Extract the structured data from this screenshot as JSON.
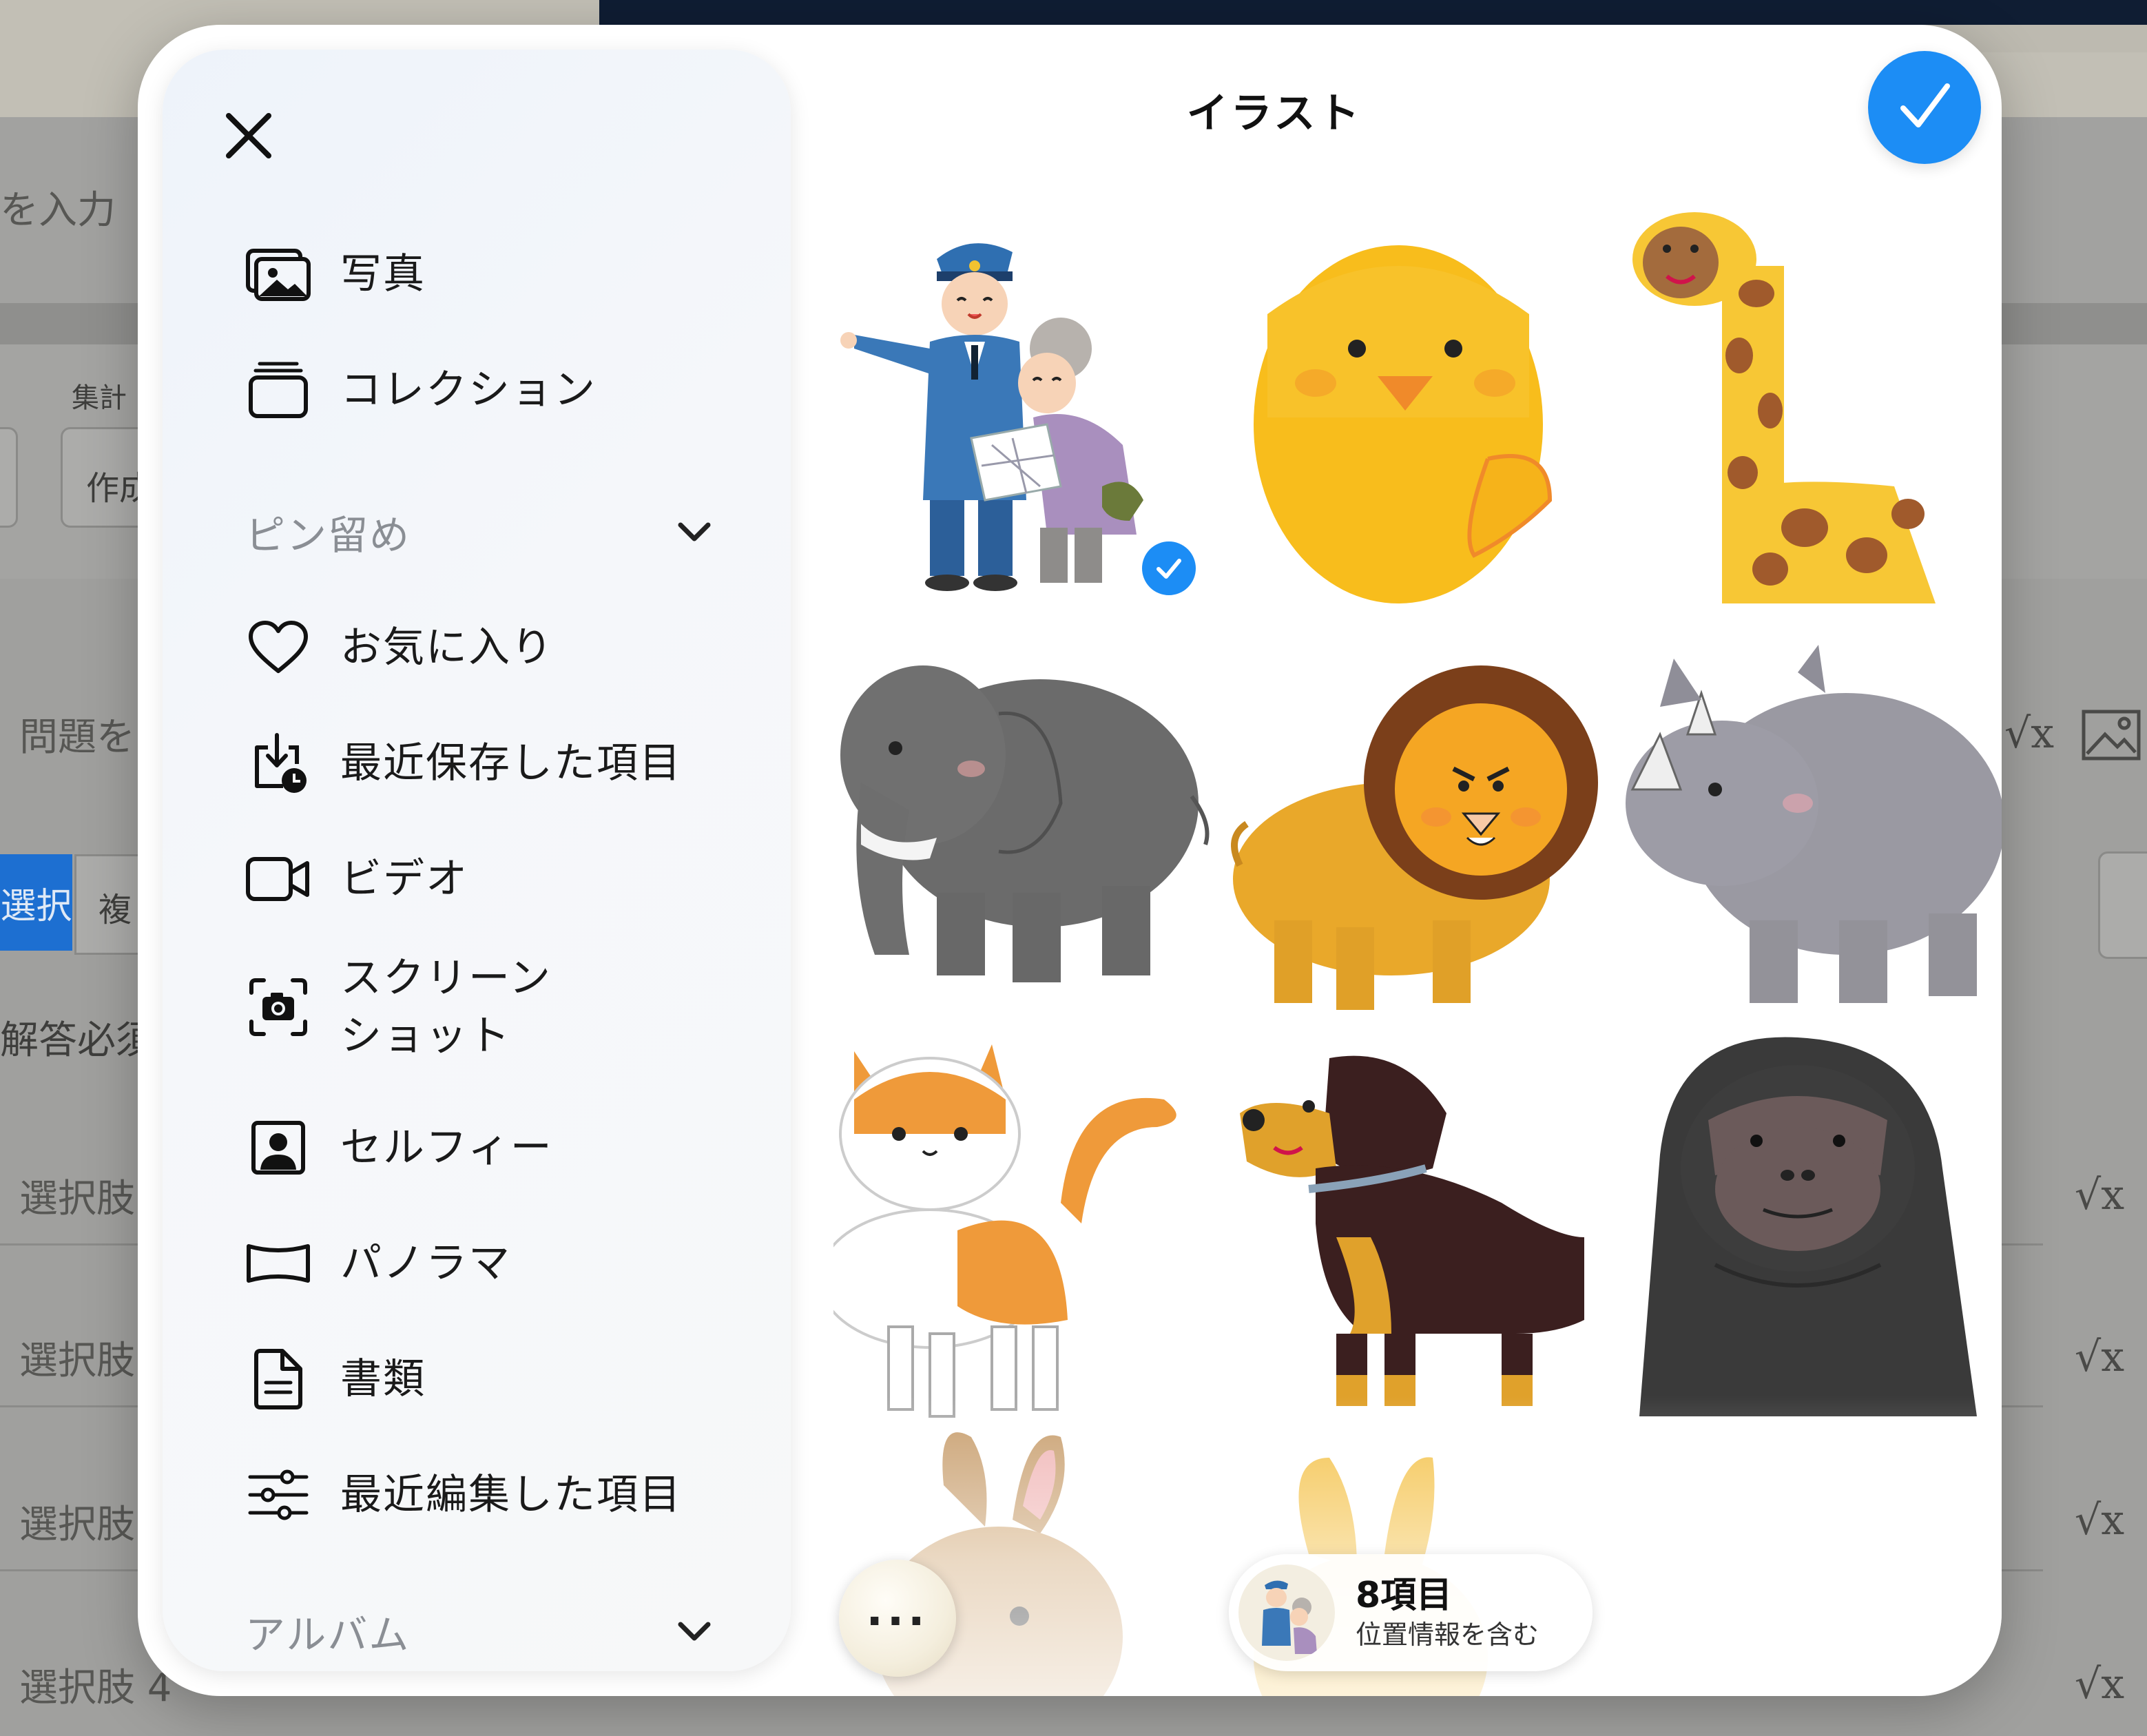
{
  "background": {
    "input_placeholder": "を入力",
    "aggregate_label": "集計",
    "created_field": "作成",
    "question_placeholder": "問題を",
    "select_button": "選択",
    "multiple_button": "複",
    "required_label": "解答必須",
    "choice_label": "選択肢",
    "choice_4_label": "選択肢 4",
    "math_icon": "sqrt-icon",
    "image_icon": "image-icon"
  },
  "modal": {
    "title": "イラスト",
    "close_icon": "close-icon",
    "done_icon": "checkmark-icon",
    "accent_color": "#1c8df5"
  },
  "sidebar": {
    "items": [
      {
        "label": "写真",
        "icon": "photos-icon"
      },
      {
        "label": "コレクション",
        "icon": "collections-icon"
      },
      {
        "label": "お気に入り",
        "icon": "heart-icon"
      },
      {
        "label": "最近保存した項目",
        "icon": "recently-saved-icon"
      },
      {
        "label": "ビデオ",
        "icon": "video-icon"
      },
      {
        "label": "スクリーンショット",
        "line1": "スクリーン",
        "line2": "ショット",
        "icon": "screenshot-icon"
      },
      {
        "label": "セルフィー",
        "icon": "selfie-icon"
      },
      {
        "label": "パノラマ",
        "icon": "panorama-icon"
      },
      {
        "label": "書類",
        "icon": "document-icon"
      },
      {
        "label": "最近編集した項目",
        "icon": "recently-edited-icon"
      }
    ],
    "sections": {
      "pinned": "ピン留め",
      "albums": "アルバム"
    }
  },
  "grid": {
    "items": [
      {
        "name": "police-officer-helping-elder",
        "selected": true
      },
      {
        "name": "yellow-chick",
        "selected": false
      },
      {
        "name": "giraffe",
        "selected": false
      },
      {
        "name": "elephant",
        "selected": false
      },
      {
        "name": "lion",
        "selected": false
      },
      {
        "name": "rhinoceros",
        "selected": false
      },
      {
        "name": "cat",
        "selected": false
      },
      {
        "name": "rottweiler-dog",
        "selected": false
      },
      {
        "name": "gorilla",
        "selected": false
      },
      {
        "name": "rabbit",
        "selected": false
      },
      {
        "name": "fennec-fox",
        "selected": false
      }
    ]
  },
  "footer": {
    "more_icon": "more-icon",
    "item_count": "8項目",
    "location_note": "位置情報を含む"
  }
}
